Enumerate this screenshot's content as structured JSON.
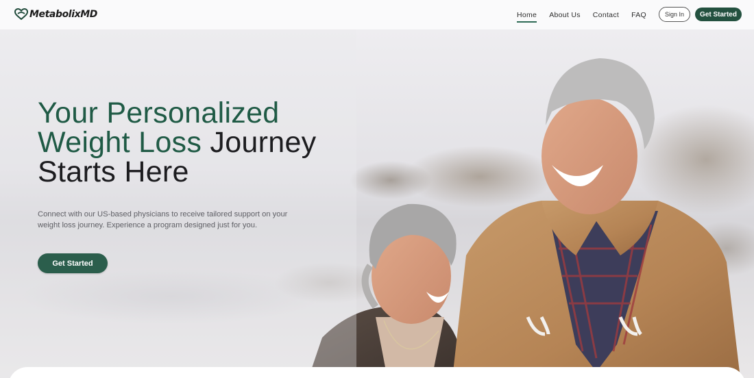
{
  "brand": {
    "name": "MetabolixMD",
    "accent": "#23513f"
  },
  "nav": {
    "items": [
      {
        "label": "Home",
        "active": true
      },
      {
        "label": "About Us",
        "active": false
      },
      {
        "label": "Contact",
        "active": false
      },
      {
        "label": "FAQ",
        "active": false
      }
    ],
    "sign_in": "Sign In",
    "get_started": "Get Started"
  },
  "hero": {
    "headline_green": "Your Personalized Weight Loss",
    "headline_rest": "Journey Starts Here",
    "subtext": "Connect with our US-based physicians to receive tailored support on your weight loss journey. Experience a program designed just for you.",
    "cta": "Get Started"
  }
}
